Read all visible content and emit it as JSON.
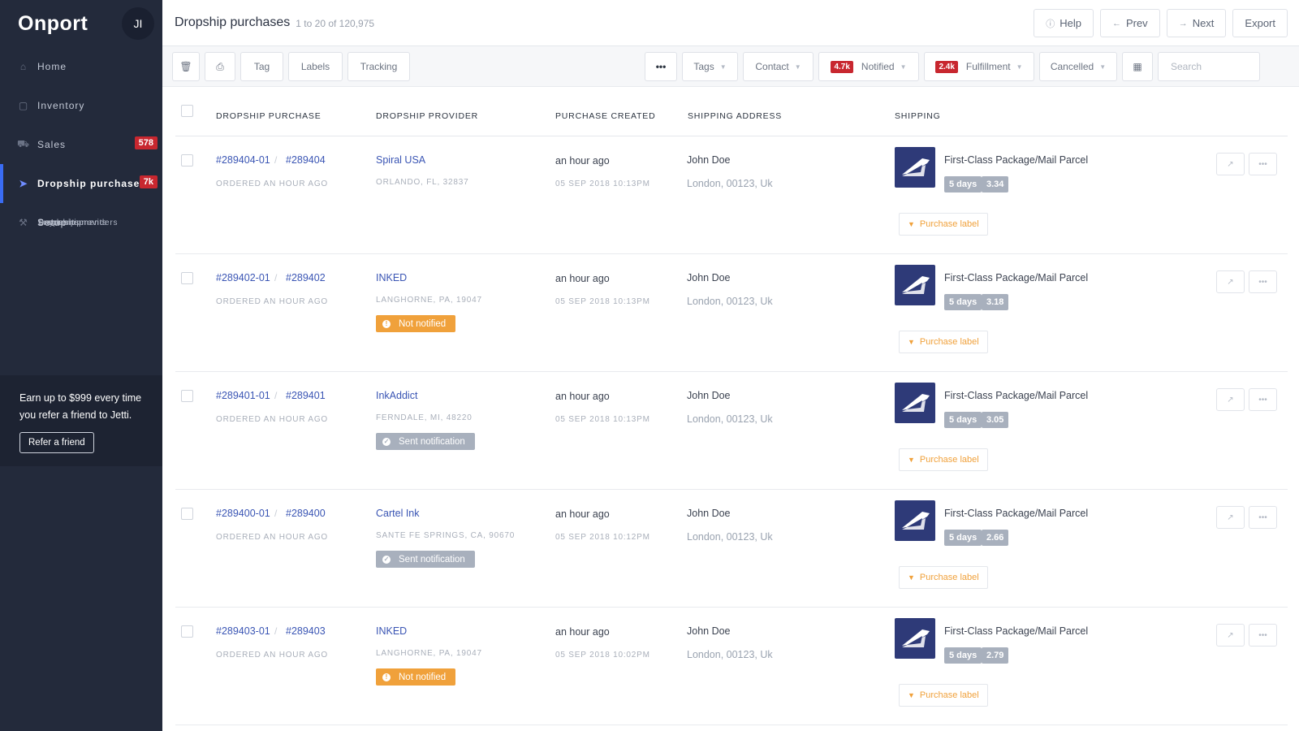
{
  "app": {
    "name": "Onport",
    "avatar": "JI"
  },
  "nav": {
    "items": [
      {
        "label": "Home",
        "icon": "home-icon"
      },
      {
        "label": "Inventory",
        "icon": "box-icon"
      },
      {
        "label": "Sales",
        "icon": "cart-icon",
        "badge": "578"
      },
      {
        "label": "Dropship purchases",
        "icon": "truck-icon",
        "badge": "7k"
      },
      {
        "label": "Dropship providers"
      },
      {
        "label": "Track shipments"
      },
      {
        "label": "Payments"
      },
      {
        "label": "Setup",
        "icon": "wrench-icon"
      }
    ]
  },
  "promo": {
    "text": "Earn up to $999 every time you refer a friend to Jetti.",
    "button": "Refer a friend"
  },
  "header": {
    "title": "Dropship purchases",
    "count": "1 to 20 of 120,975",
    "help": "Help",
    "prev": "Prev",
    "next": "Next",
    "export": "Export"
  },
  "toolbar": {
    "tag": "Tag",
    "labels": "Labels",
    "tracking": "Tracking",
    "more": "•••",
    "tags": "Tags",
    "contact": "Contact",
    "notified": "Notified",
    "notified_count": "4.7k",
    "fulfillment": "Fulfillment",
    "fulfillment_count": "2.4k",
    "cancelled": "Cancelled",
    "search_placeholder": "Search"
  },
  "columns": {
    "purchase": "DROPSHIP PURCHASE",
    "provider": "DROPSHIP PROVIDER",
    "created": "PURCHASE CREATED",
    "address": "SHIPPING ADDRESS",
    "shipping": "SHIPPING"
  },
  "colors": {
    "accent": "#3a6cf4",
    "badge": "#c8272f",
    "warn": "#f0a13b",
    "link": "#3a55b4",
    "usps": "#2e3a78"
  },
  "rows": [
    {
      "purchase_id": "#289404-01",
      "order_id": "#289404",
      "ordered": "ORDERED AN HOUR AGO",
      "provider": "Spiral USA",
      "provider_location": "ORLANDO, FL, 32837",
      "status": "",
      "status_type": "",
      "created_rel": "an hour ago",
      "created_abs": "05 SEP 2018 10:13PM",
      "name": "John Doe",
      "address": "London, 00123, Uk",
      "service": "First-Class Package/Mail Parcel",
      "days": "5 days",
      "cost": "3.34",
      "label_btn": "Purchase label"
    },
    {
      "purchase_id": "#289402-01",
      "order_id": "#289402",
      "ordered": "ORDERED AN HOUR AGO",
      "provider": "INKED",
      "provider_location": "LANGHORNE, PA, 19047",
      "status": "Not notified",
      "status_type": "warn",
      "created_rel": "an hour ago",
      "created_abs": "05 SEP 2018 10:13PM",
      "name": "John Doe",
      "address": "London, 00123, Uk",
      "service": "First-Class Package/Mail Parcel",
      "days": "5 days",
      "cost": "3.18",
      "label_btn": "Purchase label"
    },
    {
      "purchase_id": "#289401-01",
      "order_id": "#289401",
      "ordered": "ORDERED AN HOUR AGO",
      "provider": "InkAddict",
      "provider_location": "FERNDALE, MI, 48220",
      "status": "Sent notification",
      "status_type": "sent",
      "created_rel": "an hour ago",
      "created_abs": "05 SEP 2018 10:13PM",
      "name": "John Doe",
      "address": "London, 00123, Uk",
      "service": "First-Class Package/Mail Parcel",
      "days": "5 days",
      "cost": "3.05",
      "label_btn": "Purchase label"
    },
    {
      "purchase_id": "#289400-01",
      "order_id": "#289400",
      "ordered": "ORDERED AN HOUR AGO",
      "provider": "Cartel Ink",
      "provider_location": "SANTE FE SPRINGS, CA, 90670",
      "status": "Sent notification",
      "status_type": "sent",
      "created_rel": "an hour ago",
      "created_abs": "05 SEP 2018 10:12PM",
      "name": "John Doe",
      "address": "London, 00123, Uk",
      "service": "First-Class Package/Mail Parcel",
      "days": "5 days",
      "cost": "2.66",
      "label_btn": "Purchase label"
    },
    {
      "purchase_id": "#289403-01",
      "order_id": "#289403",
      "ordered": "ORDERED AN HOUR AGO",
      "provider": "INKED",
      "provider_location": "LANGHORNE, PA, 19047",
      "status": "Not notified",
      "status_type": "warn",
      "created_rel": "an hour ago",
      "created_abs": "05 SEP 2018 10:02PM",
      "name": "John Doe",
      "address": "London, 00123, Uk",
      "service": "First-Class Package/Mail Parcel",
      "days": "5 days",
      "cost": "2.79",
      "label_btn": "Purchase label"
    }
  ]
}
